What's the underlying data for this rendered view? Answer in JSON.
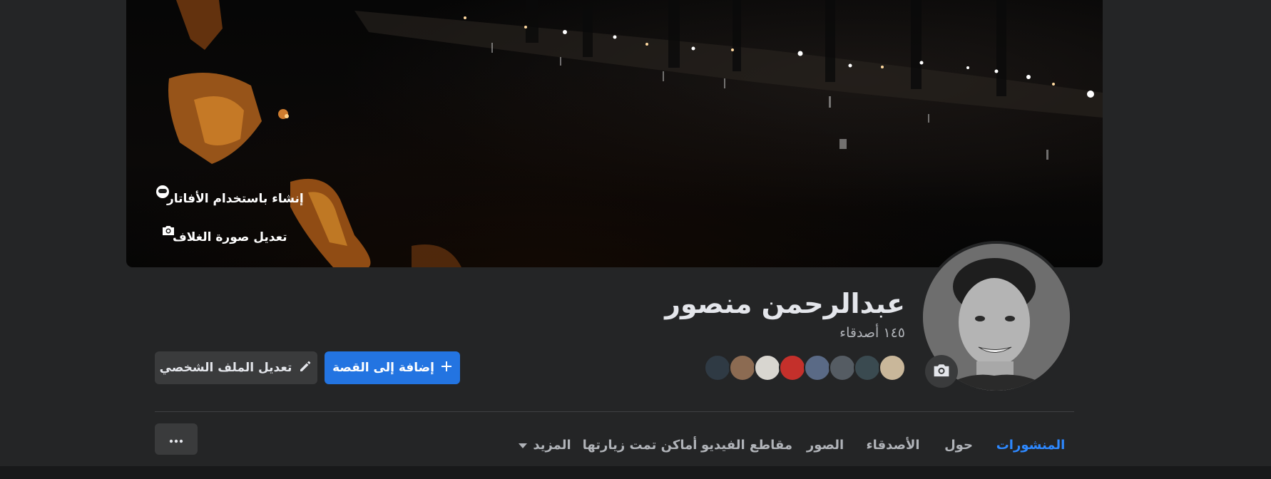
{
  "cover": {
    "avatar_button_label": "إنشاء باستخدام الأفاتار",
    "edit_cover_label": "تعديل صورة الغلاف"
  },
  "profile": {
    "name": "عبدالرحمن منصور",
    "friends_count": "١٤٥ أصدقاء",
    "friend_avatar_colors": [
      "#c9b79a",
      "#3a4a50",
      "#555c63",
      "#5a6a86",
      "#c4302b",
      "#d8d6d0",
      "#8c6b52",
      "#2f3a44"
    ]
  },
  "actions": {
    "add_story_label": "إضافة إلى القصة",
    "edit_profile_label": "تعديل الملف الشخصي"
  },
  "tabs": [
    {
      "label": "المنشورات",
      "active": true
    },
    {
      "label": "حول",
      "active": false
    },
    {
      "label": "الأصدقاء",
      "active": false
    },
    {
      "label": "الصور",
      "active": false
    },
    {
      "label": "مقاطع الفيديو",
      "active": false
    },
    {
      "label": "أماكن تمت زيارتها",
      "active": false
    },
    {
      "label": "المزيد",
      "active": false
    }
  ],
  "colors": {
    "accent": "#2d88ff",
    "primary_button": "#2374e1",
    "surface": "#242526",
    "secondary_button": "#3a3b3c"
  },
  "icons": {
    "avatar_button": "avatar-face-icon",
    "edit_cover": "camera-icon",
    "add_story": "plus-icon",
    "edit_profile": "pencil-icon",
    "more_tab": "caret-down-icon",
    "more_options": "ellipsis-icon",
    "profile_picture_update": "camera-icon"
  }
}
